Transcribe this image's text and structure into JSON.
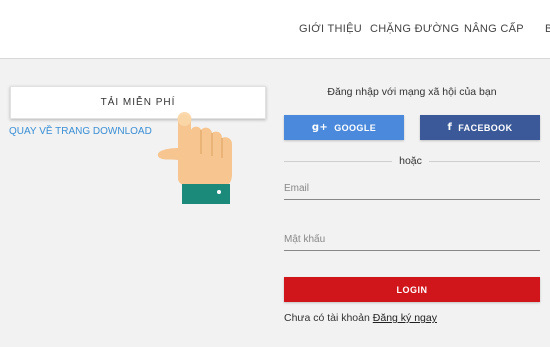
{
  "nav": {
    "items": [
      {
        "label": "GIỚI THIỆU"
      },
      {
        "label": "CHẶNG ĐƯỜNG"
      },
      {
        "label": "NÂNG CẤP"
      },
      {
        "label": "B"
      }
    ]
  },
  "download": {
    "button_label": "TẢI MIỄN PHÍ",
    "back_link": "QUAY VỀ TRANG DOWNLOAD",
    "pointer_icon": "pointing-hand-icon"
  },
  "login": {
    "title": "Đăng nhập với mạng xã hội của bạn",
    "google": {
      "icon": "g+",
      "label": "GOOGLE",
      "color": "#4a89dc"
    },
    "facebook": {
      "icon": "f",
      "label": "FACEBOOK",
      "color": "#3b5998"
    },
    "divider": "hoặc",
    "email_placeholder": "Email",
    "password_placeholder": "Mật khẩu",
    "submit": {
      "label": "LOGIN",
      "color": "#d0161b"
    },
    "no_account_text": "Chưa có tài khoản",
    "register_link": "Đăng ký ngay"
  }
}
